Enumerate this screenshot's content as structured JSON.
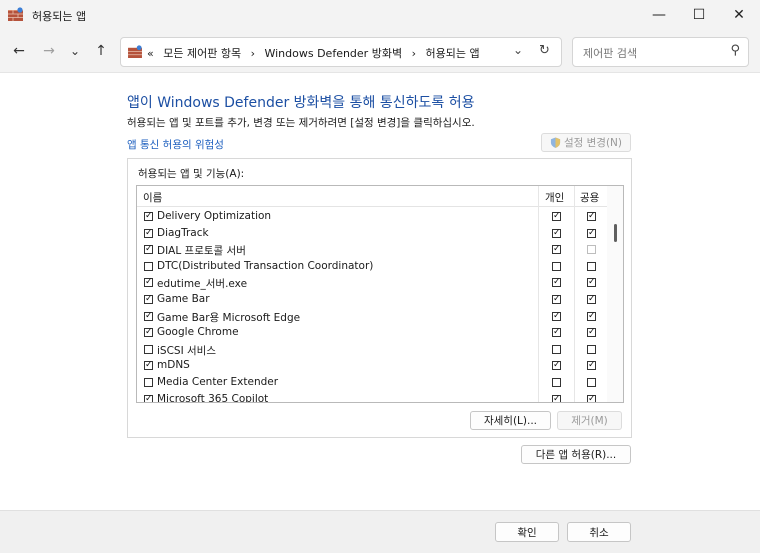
{
  "window": {
    "title": "허용되는 앱",
    "minimize_glyph": "—",
    "maximize_glyph": "☐",
    "close_glyph": "✕"
  },
  "nav": {
    "back_glyph": "←",
    "forward_glyph": "→",
    "recent_glyph": "⌄",
    "up_glyph": "↑",
    "breadcrumb": [
      "«",
      "모든 제어판 항목",
      "›",
      "Windows Defender 방화벽",
      "›",
      "허용되는 앱"
    ],
    "dropdown_glyph": "⌄",
    "refresh_glyph": "↻",
    "search_placeholder": "제어판 검색",
    "search_glyph": "⚲"
  },
  "content": {
    "title": "앱이 Windows Defender 방화벽을 통해 통신하도록 허용",
    "description": "허용되는 앱 및 포트를 추가, 변경 또는 제거하려면 [설정 변경]을 클릭하십시오.",
    "risk_link": "앱 통신 허용의 위험성",
    "change_settings_button": "설정 변경(N)",
    "group_label": "허용되는 앱 및 기능(A):",
    "columns": {
      "name": "이름",
      "private": "개인",
      "public": "공용"
    },
    "apps": [
      {
        "name": "Delivery Optimization",
        "enabled": true,
        "private": true,
        "public": true
      },
      {
        "name": "DiagTrack",
        "enabled": true,
        "private": true,
        "public": true
      },
      {
        "name": "DIAL 프로토콜 서버",
        "enabled": true,
        "private": true,
        "public": false
      },
      {
        "name": "DTC(Distributed Transaction Coordinator)",
        "enabled": false,
        "private": false,
        "public": false
      },
      {
        "name": "edutime_서버.exe",
        "enabled": true,
        "private": true,
        "public": true
      },
      {
        "name": "Game Bar",
        "enabled": true,
        "private": true,
        "public": true
      },
      {
        "name": "Game Bar용 Microsoft Edge",
        "enabled": true,
        "private": true,
        "public": true
      },
      {
        "name": "Google Chrome",
        "enabled": true,
        "private": true,
        "public": true
      },
      {
        "name": "iSCSI 서비스",
        "enabled": false,
        "private": false,
        "public": false
      },
      {
        "name": "mDNS",
        "enabled": true,
        "private": true,
        "public": true
      },
      {
        "name": "Media Center Extender",
        "enabled": false,
        "private": false,
        "public": false
      },
      {
        "name": "Microsoft 365 Copilot",
        "enabled": true,
        "private": true,
        "public": true
      }
    ],
    "details_button": "자세히(L)...",
    "remove_button": "제거(M)",
    "allow_other_button": "다른 앱 허용(R)..."
  },
  "footer": {
    "ok_button": "확인",
    "cancel_button": "취소"
  },
  "colors": {
    "title_blue": "#1c4fa3",
    "link_blue": "#1d5fbf"
  }
}
